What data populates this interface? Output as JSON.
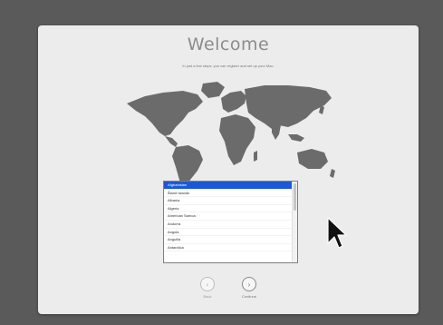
{
  "window": {
    "title": "Welcome",
    "subtitle": "In just a few steps, you can register and set up your Mac."
  },
  "country_list": {
    "items": [
      {
        "label": "Afghanistan",
        "selected": true
      },
      {
        "label": "Åland Islands",
        "selected": false
      },
      {
        "label": "Albania",
        "selected": false
      },
      {
        "label": "Algeria",
        "selected": false
      },
      {
        "label": "American Samoa",
        "selected": false
      },
      {
        "label": "Andorra",
        "selected": false
      },
      {
        "label": "Angola",
        "selected": false
      },
      {
        "label": "Anguilla",
        "selected": false
      },
      {
        "label": "Antarctica",
        "selected": false
      }
    ]
  },
  "nav": {
    "back_label": "Back",
    "back_icon": "chevron-left-icon",
    "continue_label": "Continue",
    "continue_icon": "chevron-right-icon"
  },
  "colors": {
    "selection": "#1b58d8",
    "map_land": "#6b6b6b",
    "desktop": "#5a5a5a"
  }
}
